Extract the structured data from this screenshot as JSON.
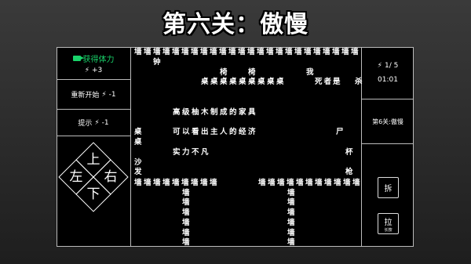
{
  "title": "第六关：傲慢",
  "left_panel": {
    "energy_label": "获得体力",
    "energy_bonus": "+3",
    "restart_label": "重新开始",
    "restart_cost": "-1",
    "hint_label": "提示",
    "hint_cost": "-1",
    "dpad": {
      "up": "上",
      "down": "下",
      "left": "左",
      "right": "右"
    }
  },
  "right_panel": {
    "energy": "1/ 5",
    "timer": "01:01",
    "level_name": "第6关:傲慢",
    "dismantle_label": "拆",
    "pull_label": "拉",
    "pull_sub": "长按"
  },
  "board": {
    "top_wall": "墙墙墙墙墙墙墙墙墙墙墙墙墙墙墙墙墙墙墙墙墙墙墙墙",
    "clock": "钟",
    "chair_left": "椅",
    "chair_right": "椅",
    "me": "我",
    "tables_row": "桌桌桌桌桌桌桌桌桌",
    "dead": "死者是",
    "kill": "杀",
    "desc1": "高级柚木制成的家具",
    "desc2": "可以看出主人的经济",
    "desc3": "实力不凡",
    "table_a": "桌",
    "table_b": "桌",
    "corpse": "尸",
    "cup": "杯",
    "sofa_a": "沙",
    "sofa_b": "发",
    "gun": "枪",
    "bottom_wall_left": "墙墙墙墙墙墙墙墙墙",
    "bottom_wall_right": "墙墙墙墙墙墙墙墙墙墙墙",
    "wall_col_a": [
      "墙",
      "墙",
      "墙",
      "墙",
      "墙",
      "墙"
    ],
    "wall_col_b": [
      "墙",
      "墙",
      "墙",
      "墙",
      "墙",
      "墙"
    ]
  }
}
